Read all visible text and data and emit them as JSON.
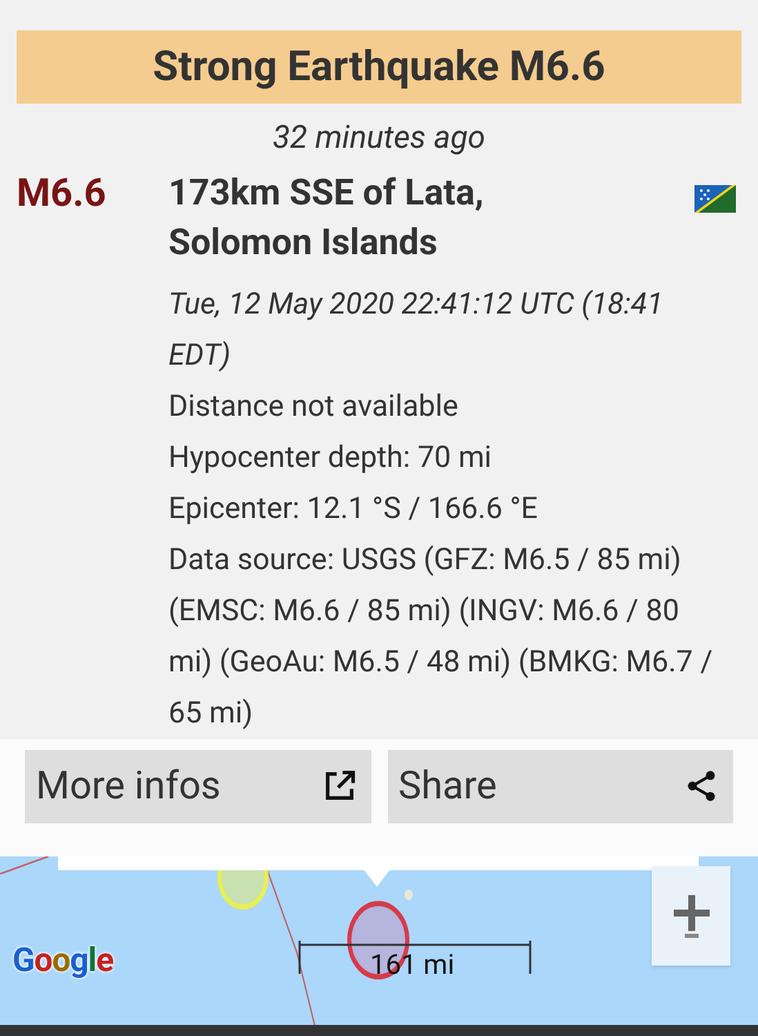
{
  "title": "Strong Earthquake M6.6",
  "time_ago": "32 minutes ago",
  "magnitude": "M6.6",
  "location": "173km SSE of Lata, Solomon Islands",
  "details": [
    {
      "kind": "italic",
      "text": "Tue, 12 May 2020 22:41:12 UTC (18:41 EDT)"
    },
    {
      "kind": "plain",
      "text": "Distance not available"
    },
    {
      "kind": "plain",
      "text": "Hypocenter depth: 70 mi"
    },
    {
      "kind": "plain",
      "text": "Epicenter: 12.1 °S / 166.6 °E"
    },
    {
      "kind": "plain",
      "text": "Data source: USGS (GFZ: M6.5 / 85 mi) (EMSC: M6.6 / 85 mi) (INGV: M6.6 / 80 mi) (GeoAu: M6.5 / 48 mi) (BMKG: M6.7 / 65 mi)"
    }
  ],
  "buttons": [
    {
      "kind": "external",
      "label": "More infos"
    },
    {
      "kind": "share",
      "label": "Share"
    }
  ],
  "map": {
    "scale": "161 mi",
    "attribution": "Google"
  }
}
